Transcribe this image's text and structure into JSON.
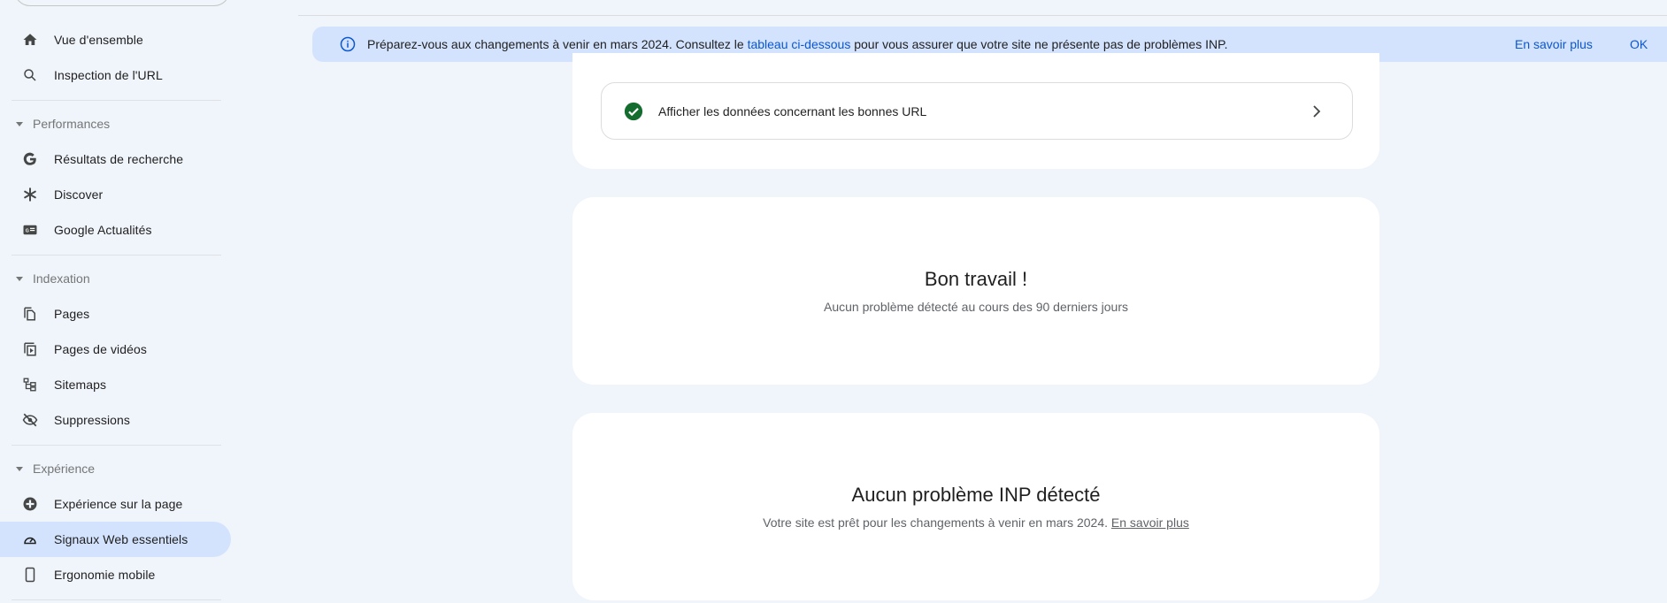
{
  "sidebar": {
    "search_placeholder": "",
    "items_top": [
      {
        "label": "Vue d'ensemble",
        "icon": "home-icon"
      },
      {
        "label": "Inspection de l'URL",
        "icon": "search-icon"
      }
    ],
    "sections": [
      {
        "title": "Performances",
        "items": [
          {
            "label": "Résultats de recherche",
            "icon": "google-g-icon"
          },
          {
            "label": "Discover",
            "icon": "asterisk-icon"
          },
          {
            "label": "Google Actualités",
            "icon": "google-news-icon"
          }
        ]
      },
      {
        "title": "Indexation",
        "items": [
          {
            "label": "Pages",
            "icon": "pages-icon"
          },
          {
            "label": "Pages de vidéos",
            "icon": "video-pages-icon"
          },
          {
            "label": "Sitemaps",
            "icon": "sitemap-icon"
          },
          {
            "label": "Suppressions",
            "icon": "eye-off-icon"
          }
        ]
      },
      {
        "title": "Expérience",
        "items": [
          {
            "label": "Expérience sur la page",
            "icon": "page-experience-icon"
          },
          {
            "label": "Signaux Web essentiels",
            "icon": "gauge-icon",
            "active": true
          },
          {
            "label": "Ergonomie mobile",
            "icon": "phone-icon"
          }
        ]
      }
    ]
  },
  "banner": {
    "text_before": "Préparez-vous aux changements à venir en mars 2024. Consultez le ",
    "link_text": "tableau ci-dessous",
    "text_after": " pour vous assurer que votre site ne présente pas de problèmes INP.",
    "learn_more": "En savoir plus",
    "ok": "OK"
  },
  "good_urls": {
    "label": "Afficher les données concernant les bonnes URL"
  },
  "card_good_work": {
    "title": "Bon travail !",
    "subtitle": "Aucun problème détecté au cours des 90 derniers jours"
  },
  "card_inp": {
    "title": "Aucun problème INP détecté",
    "subtitle": "Votre site est prêt pour les changements à venir en mars 2024. ",
    "link": "En savoir plus"
  },
  "colors": {
    "accent": "#0b57d0",
    "active_nav": "#d3e3fd",
    "success": "#146c2e",
    "background": "#f0f4fb"
  }
}
